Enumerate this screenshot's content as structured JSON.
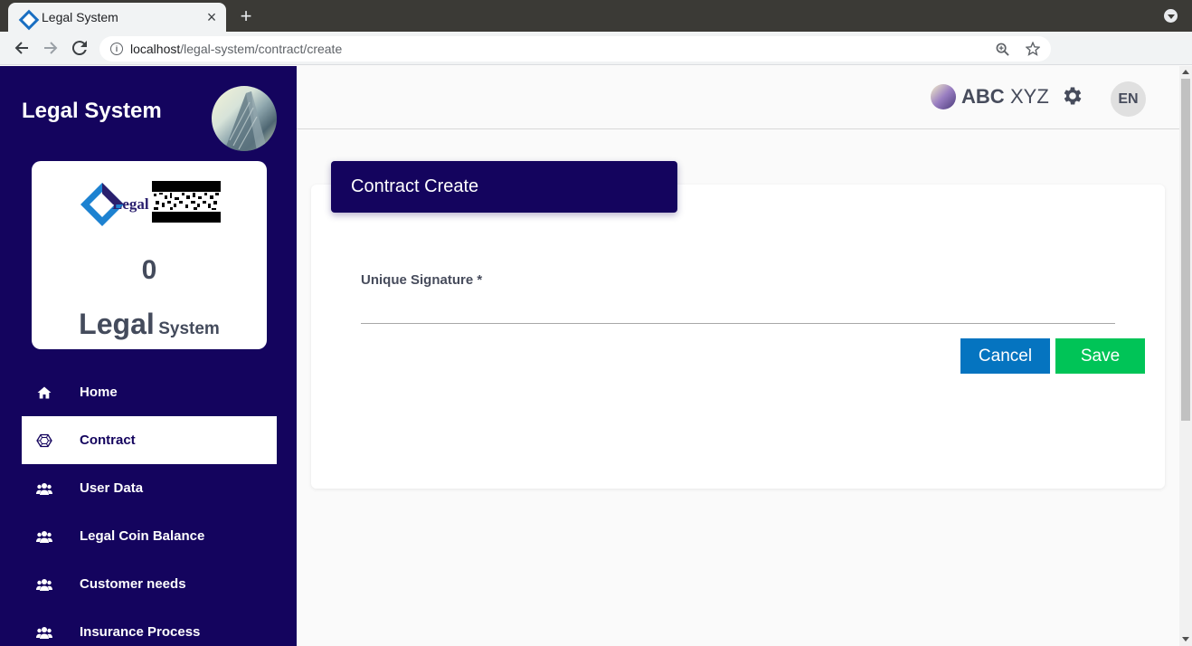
{
  "browser": {
    "tab_title": "Legal System",
    "url_host": "localhost",
    "url_path": "/legal-system/contract/create",
    "icons": {
      "tab_close": "close-icon",
      "new_tab": "plus-icon",
      "back": "arrow-left-icon",
      "forward": "arrow-right-icon",
      "reload": "reload-icon",
      "site_info": "info-icon",
      "zoom": "zoom-icon",
      "bookmark": "star-icon"
    }
  },
  "sidebar": {
    "title": "Legal System",
    "card": {
      "logo_text": "Legal",
      "count": "0",
      "name_primary": "Legal",
      "name_secondary": "System"
    },
    "items": [
      {
        "label": "Home",
        "icon": "home-icon",
        "active": false
      },
      {
        "label": "Contract",
        "icon": "hexagon-icon",
        "active": true
      },
      {
        "label": "User Data",
        "icon": "users-icon",
        "active": false
      },
      {
        "label": "Legal Coin Balance",
        "icon": "users-icon",
        "active": false
      },
      {
        "label": "Customer needs",
        "icon": "users-icon",
        "active": false
      },
      {
        "label": "Insurance Process",
        "icon": "users-icon",
        "active": false
      }
    ]
  },
  "header": {
    "user_first": "ABC",
    "user_last": "XYZ",
    "settings_icon": "gear-icon",
    "language": "EN"
  },
  "form": {
    "title": "Contract Create",
    "signature_label": "Unique Signature *",
    "signature_value": "",
    "cancel_label": "Cancel",
    "save_label": "Save"
  },
  "colors": {
    "sidebar_bg": "#14045e",
    "cancel_bg": "#0574c0",
    "save_bg": "#00c457",
    "text_dark": "#474c5c"
  }
}
